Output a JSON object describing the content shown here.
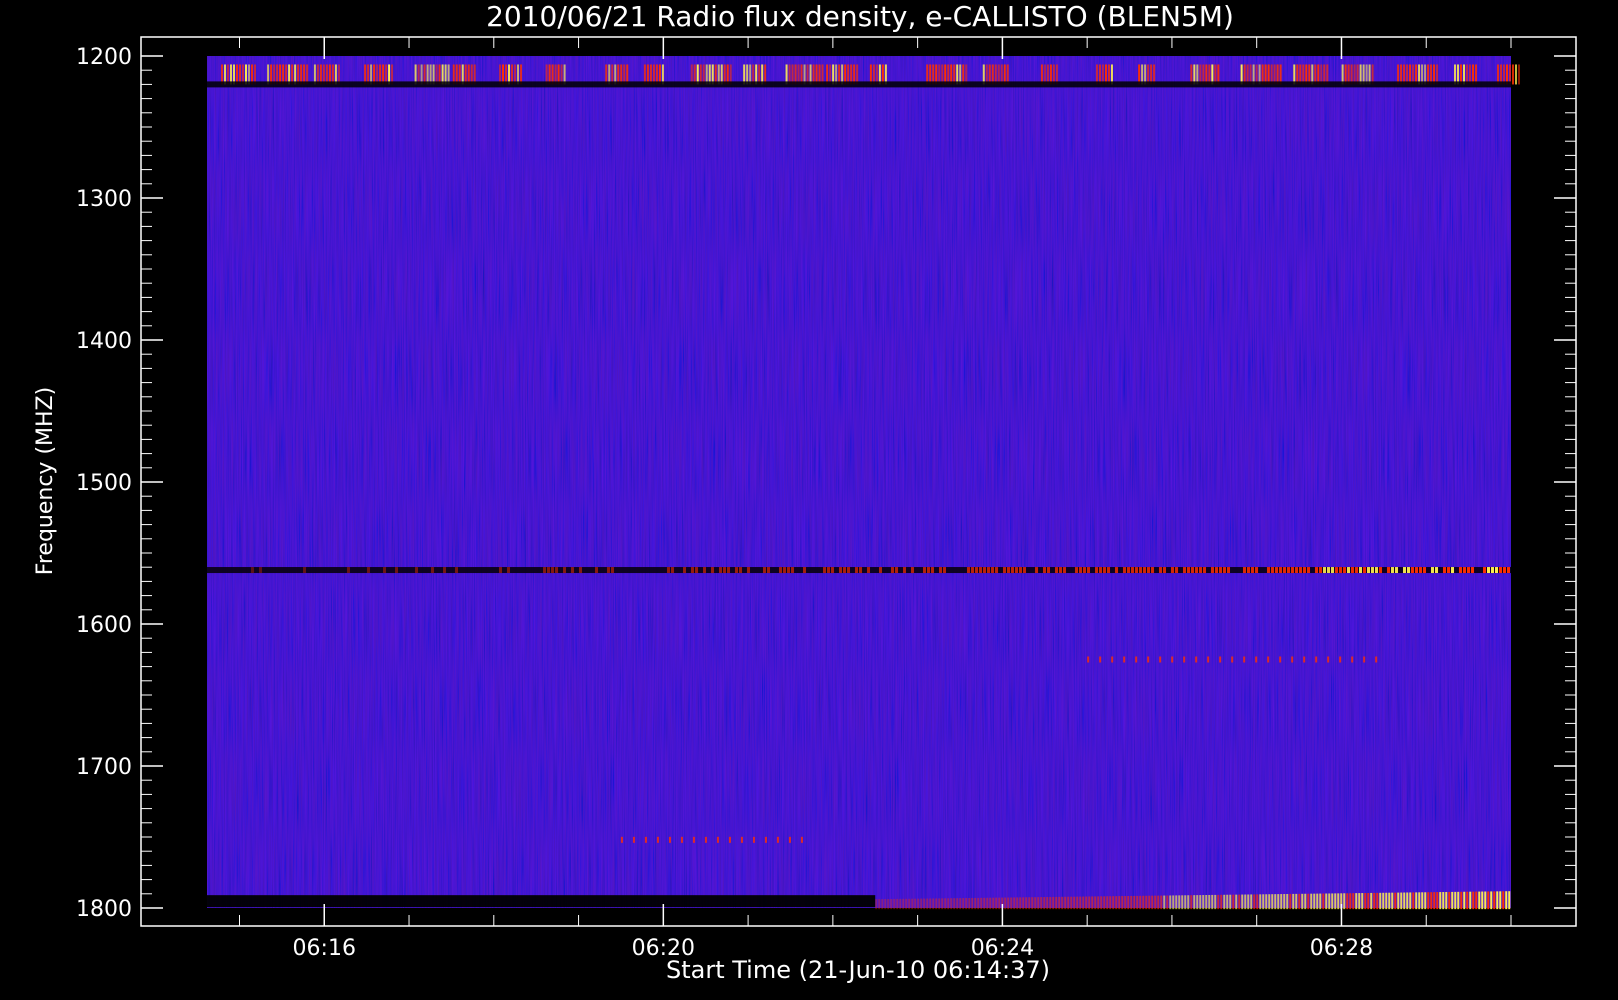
{
  "chart_data": {
    "type": "heatmap",
    "title": "2010/06/21  Radio flux density, e-CALLISTO (BLEN5M)",
    "xlabel": "Start Time (21-Jun-10 06:14:37)",
    "ylabel": "Frequency (MHZ)",
    "x_axis": {
      "unit": "time",
      "range": [
        "06:14:37",
        "06:30:00"
      ],
      "ticks": [
        "06:16",
        "06:20",
        "06:24",
        "06:28"
      ]
    },
    "y_axis": {
      "unit": "MHz",
      "range": [
        1200,
        1800
      ],
      "inverted": true,
      "ticks": [
        1200,
        1300,
        1400,
        1500,
        1600,
        1700,
        1800
      ]
    },
    "background_color": "#2a1fd6",
    "colors": {
      "background": "#000000",
      "axis": "#ffffff",
      "low": "#1a10c8",
      "mid": "#6a1a9a",
      "high": "#ff3000",
      "peak": "#ffee50"
    },
    "features": [
      {
        "name": "emission band",
        "freq_mhz": 1213,
        "t_start": "06:14:37",
        "t_end": "06:30:00",
        "intensity": "high",
        "pattern": "intermittent"
      },
      {
        "name": "dark gap",
        "freq_mhz": 1220,
        "t_start": "06:14:37",
        "t_end": "06:30:00",
        "intensity": "none"
      },
      {
        "name": "emission line",
        "freq_mhz": 1562,
        "t_start": "06:14:37",
        "t_end": "06:30:00",
        "intensity": "rising"
      },
      {
        "name": "faint line",
        "freq_mhz": 1625,
        "t_start": "06:25:00",
        "t_end": "06:28:30",
        "intensity": "low"
      },
      {
        "name": "dotted line",
        "freq_mhz": 1752,
        "t_start": "06:19:30",
        "t_end": "06:21:45",
        "intensity": "low"
      },
      {
        "name": "low-edge burst",
        "freq_mhz": 1798,
        "t_start": "06:22:30",
        "t_end": "06:30:00",
        "intensity": "peak"
      }
    ]
  }
}
